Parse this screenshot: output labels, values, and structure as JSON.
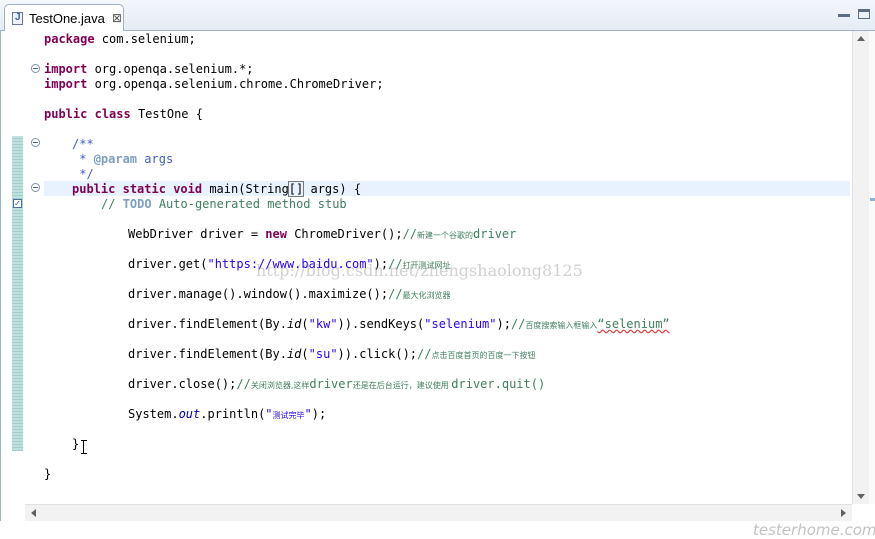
{
  "tab": {
    "label": "TestOne.java",
    "close": "⊠"
  },
  "icons": {
    "file": "java-file-icon",
    "close": "close-icon",
    "fold": "fold-icon",
    "task": "task-icon"
  },
  "colors": {
    "keyword": "#7f0055",
    "comment": "#3f7f5f",
    "javadoc": "#3f5fbf",
    "string": "#2a00ff",
    "field": "#0000c0",
    "change_bar": "#bfe0dc",
    "current_line": "#e8f2fe"
  },
  "code": {
    "l_package_kw": "package",
    "l_package_rest": " com.selenium;",
    "l_import_kw": "import",
    "l_import1_rest": " org.openqa.selenium.*;",
    "l_import2_rest": " org.openqa.selenium.chrome.ChromeDriver;",
    "l_public": "public",
    "l_class": "class",
    "l_class_name": " TestOne {",
    "l_jd_open": "/**",
    "l_jd_star": " * ",
    "l_jd_param": "@param",
    "l_jd_args": " args",
    "l_jd_close": " */",
    "l_static": "static",
    "l_void": "void",
    "l_main_pre": " main(String",
    "l_main_bracket": "[]",
    "l_main_post": " args) {",
    "l_todo_pre": "// ",
    "l_todo": "TODO",
    "l_todo_post": " Auto-generated method stub",
    "l_wd_pre": "WebDriver driver = ",
    "l_new": "new",
    "l_wd_post": " ChromeDriver();",
    "l_wd_c1": "//",
    "l_wd_c2": "新建一个谷歌的",
    "l_wd_c3": "driver",
    "l_get_pre": "driver.get(",
    "l_get_str": "\"https://www.baidu.com\"",
    "l_get_post": ");",
    "l_get_c1": "//",
    "l_get_c2": "打开测试网址",
    "l_max_pre": "driver.manage().window().maximize();",
    "l_max_c1": "//",
    "l_max_c2": "最大化浏览器",
    "l_find1_pre": "driver.findElement(By.",
    "l_id": "id",
    "l_find1_mid": "(",
    "l_kw_str": "\"kw\"",
    "l_find1_post": ")).sendKeys(",
    "l_sel_str": "\"selenium\"",
    "l_find1_end": ");",
    "l_find1_c1": "//",
    "l_find1_c2": "百度搜索输入框输入",
    "l_find1_c3": "“selenium”",
    "l_su_str": "\"su\"",
    "l_find2_post": ")).click();",
    "l_find2_c1": "//",
    "l_find2_c2": "点击百度首页的百度一下按钮",
    "l_close_pre": "driver.close();",
    "l_close_c1": "//",
    "l_close_c2": "关闭浏览器,这样",
    "l_close_c3": "driver",
    "l_close_c4": "还是在后台运行，建议使用 ",
    "l_close_c5": "driver.quit()",
    "l_sys_pre": "System.",
    "l_out": "out",
    "l_sys_mid": ".println(",
    "l_sys_q1": "\"",
    "l_sys_cn": "测试完毕",
    "l_sys_q2": "\"",
    "l_sys_post": ");",
    "l_brace1": "}",
    "l_brace2": "}"
  },
  "watermark": "http://blog.csdn.net/zhengshaolong8125",
  "corner_watermark": "testerhome.com"
}
